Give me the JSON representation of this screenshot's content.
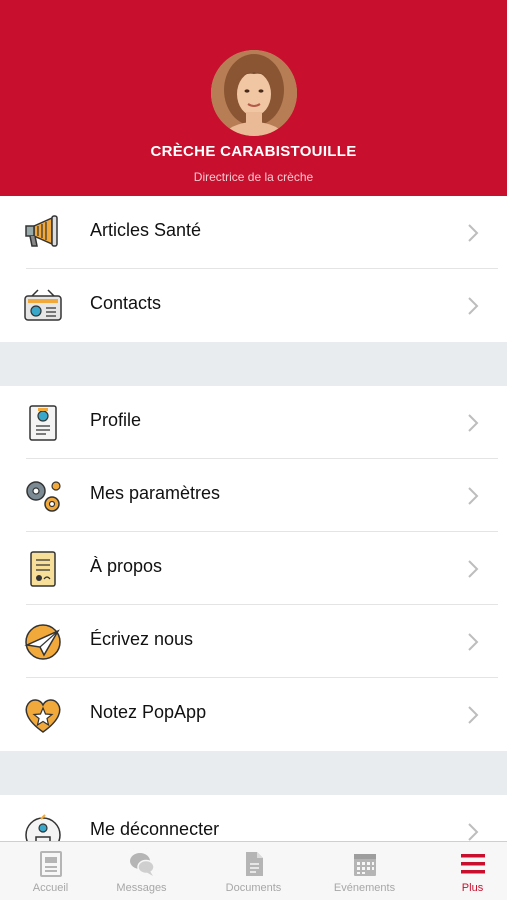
{
  "header": {
    "org_name": "CRÈCHE CARABISTOUILLE",
    "role": "Directrice de la crèche",
    "background": "#c8102e"
  },
  "menu": {
    "section1": [
      {
        "label": "Articles Santé",
        "icon": "megaphone-icon"
      },
      {
        "label": "Contacts",
        "icon": "radio-contacts-icon"
      }
    ],
    "section2": [
      {
        "label": "Profile",
        "icon": "profile-card-icon"
      },
      {
        "label": "Mes paramètres",
        "icon": "gears-icon"
      },
      {
        "label": "À propos",
        "icon": "certificate-icon"
      },
      {
        "label": "Écrivez nous",
        "icon": "paper-plane-icon"
      },
      {
        "label": "Notez PopApp",
        "icon": "heart-star-icon"
      }
    ],
    "section3": [
      {
        "label": "Me déconnecter",
        "icon": "logout-person-icon"
      }
    ]
  },
  "tabbar": {
    "active_color": "#c8102e",
    "tabs": [
      {
        "label": "Accueil",
        "icon": "home-doc-icon"
      },
      {
        "label": "Messages",
        "icon": "chat-bubbles-icon"
      },
      {
        "label": "Documents",
        "icon": "document-icon"
      },
      {
        "label": "Evénements",
        "icon": "calendar-icon"
      },
      {
        "label": "Plus",
        "icon": "hamburger-menu-icon",
        "active": true
      }
    ]
  }
}
